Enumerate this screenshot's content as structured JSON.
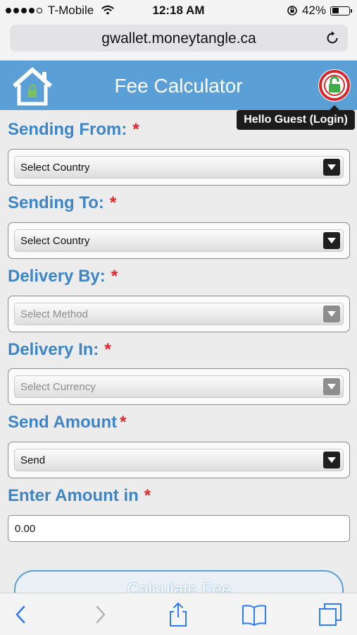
{
  "status_bar": {
    "carrier": "T-Mobile",
    "time": "12:18 AM",
    "battery": "42%",
    "battery_level": 0.42
  },
  "browser": {
    "url": "gwallet.moneytangle.ca"
  },
  "header": {
    "title": "Fee Calculator",
    "login_tooltip": "Hello Guest (Login)"
  },
  "form": {
    "sending_from": {
      "label": "Sending From:",
      "value": "Select Country"
    },
    "sending_to": {
      "label": "Sending To:",
      "value": "Select Country"
    },
    "delivery_by": {
      "label": "Delivery By:",
      "value": "Select Method"
    },
    "delivery_in": {
      "label": "Delivery In:",
      "value": "Select Currency"
    },
    "send_amount": {
      "label": "Send Amount",
      "value": "Send"
    },
    "enter_amount": {
      "label": "Enter Amount in",
      "value": "0.00"
    },
    "required_mark": "*",
    "calculate_label": "Calculate Fee"
  },
  "colors": {
    "accent": "#5a9fd6",
    "label": "#3d85c6",
    "required": "#e0262a",
    "ios_blue": "#2f7cf6"
  }
}
